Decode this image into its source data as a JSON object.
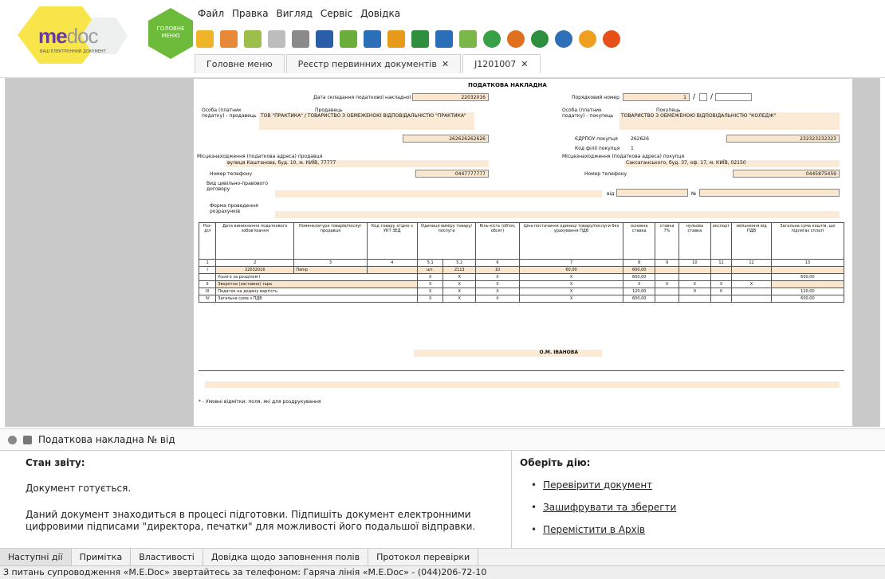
{
  "app": {
    "logo_text_main": "me",
    "logo_text_rest": "doc",
    "logo_sub": "ВАШ ЕЛЕКТРОННИЙ ДОКУМЕНТ",
    "home_label": "ГОЛОВНЕ МЕНЮ"
  },
  "menu": [
    "Файл",
    "Правка",
    "Вигляд",
    "Сервіс",
    "Довідка"
  ],
  "toolbar_icons": [
    {
      "name": "new-doc-icon",
      "color": "#f0b429"
    },
    {
      "name": "delete-doc-icon",
      "color": "#e8893a"
    },
    {
      "name": "archive-icon",
      "color": "#9bbf4a"
    },
    {
      "name": "stamp-icon",
      "color": "#bdbdbd"
    },
    {
      "name": "sign-icon",
      "color": "#8a8a8a"
    },
    {
      "name": "encrypt-icon",
      "color": "#2a5ea8"
    },
    {
      "name": "list-icon",
      "color": "#6cae3c"
    },
    {
      "name": "print-icon",
      "color": "#2a6fb8"
    },
    {
      "name": "send-icon",
      "color": "#e89b1a"
    },
    {
      "name": "receive-icon",
      "color": "#2e8f3e"
    },
    {
      "name": "search-icon",
      "color": "#2a6fb8"
    },
    {
      "name": "check-icon",
      "color": "#7ab648"
    },
    {
      "name": "refresh-icon",
      "color": "#3aa045"
    },
    {
      "name": "table-icon",
      "color": "#e07020"
    },
    {
      "name": "shield-icon",
      "color": "#2e8f3e"
    },
    {
      "name": "update-icon",
      "color": "#2e6fb8"
    },
    {
      "name": "help-icon",
      "color": "#f0a020"
    },
    {
      "name": "chat-icon",
      "color": "#e8501a"
    }
  ],
  "tabs": [
    {
      "label": "Головне меню"
    },
    {
      "label": "Реєстр первинних документів"
    },
    {
      "label": "J1201007"
    }
  ],
  "doc": {
    "title": "ПОДАТКОВА НАКЛАДНА",
    "date_label": "Дата складання податкової накладної",
    "date_value": "22032016",
    "serial_label": "Порядковий номер",
    "serial_value": "1",
    "seller_label": "Продавець",
    "buyer_label": "Покупець",
    "person_label": "Особа (платник податку) - продавець",
    "person_buyer_label": "Особа (платник податку) - покупець",
    "seller_name": "ТОВ \"ПРАКТИКА\" / ТОВАРИСТВО З ОБМЕЖЕНОЮ ВІДПОВІДАЛЬНІСТЮ \"ПРАКТИКА\"",
    "buyer_name": "ТОВАРИСТВО З ОБМЕЖЕНОЮ ВІДПОВІДАЛЬНІСТЮ \"КОЛЕДЖ\"",
    "seller_ipn": "262626262626",
    "buyer_ipn": "232323232323",
    "edrpou_label": "ЄДРПОУ покупця",
    "edrpou_value": "262626",
    "branch_label": "Код філії покупця",
    "branch_value": "1",
    "address_label": "Місцезнаходження (податкова адреса) продавця",
    "seller_address": "вулиця Каштанова, буд. 10, м. КИЇВ, 77777",
    "address_buyer_label": "Місцезнаходження (податкова адреса) покупця",
    "buyer_address": "Саксаганського, буд. 37, оф. 17, м. КИЇВ, 02150",
    "phone_label": "Номер телефону",
    "seller_phone": "0447777777",
    "buyer_phone": "0445875459",
    "contract_label": "Вид цивільно-правового договору",
    "from_label": "від",
    "no_label": "№",
    "payment_label": "Форма проведення розрахунків",
    "signer": "О.М. ІВАНОВА",
    "footnote": "* - Умовні відмітки: поля, які для роздрукування"
  },
  "table": {
    "headers": [
      "Роз-діл",
      "Дата виникнення податкового зобов'язання",
      "Номенклатура товарів/послуг продавця",
      "Код товару згідно з УКТ ЗЕД",
      "Одиниця виміру товару/послуги",
      "Кіль-кість (об'єм, обсяг)",
      "Ціна постачання одиниці товару/послуги без урахування ПДВ",
      "основна ставка",
      "ставка 7%",
      "нульова ставка",
      "експорт",
      "звільнення від ПДВ",
      "Загальна сума коштів, що підлягає сплаті"
    ],
    "numbers": [
      "1",
      "2",
      "3",
      "4",
      "5.1",
      "5.2",
      "6",
      "7",
      "8",
      "9",
      "10",
      "11",
      "12",
      "13"
    ],
    "row1": {
      "date": "22032016",
      "name": "Папір",
      "unit": "шт.",
      "code": "2113",
      "qty": "10",
      "price": "60,00",
      "base": "600,00"
    },
    "sum_label": "Усього за розділом І",
    "sum_value": "600,00",
    "sum_total": "600,00",
    "r2_num": "II",
    "r2_label": "Зворотна (заставна) тара",
    "r3_num": "III",
    "r3_label": "Податок на додану вартість",
    "r3_base": "120,00",
    "r3_zero": "0",
    "r3_exp": "0",
    "r3_total": "120,00",
    "r4_num": "IV",
    "r4_label": "Загальна сума з ПДВ",
    "r4_base": "600,00",
    "r4_total": "600,00",
    "x": "X"
  },
  "strip": {
    "label": "Податкова накладна  № від"
  },
  "status": {
    "title": "Стан звіту:",
    "line1": "Документ готується.",
    "line2": "Даний документ знаходиться в процесі підготовки. Підпишіть документ електронними цифровими підписами \"директора, печатки\" для можливості його подальшої відправки."
  },
  "actions": {
    "title": "Оберіть дію:",
    "items": [
      "Перевірити документ",
      "Зашифрувати та зберегти",
      "Перемістити в Архів"
    ]
  },
  "bottom_tabs": [
    "Наступні дії",
    "Примітка",
    "Властивості",
    "Довідка щодо заповнення полів",
    "Протокол перевірки"
  ],
  "statusbar": "З питань супроводження «M.E.Doc» звертайтесь за телефоном: Гаряча лінія «M.E.Doc» - (044)206-72-10"
}
